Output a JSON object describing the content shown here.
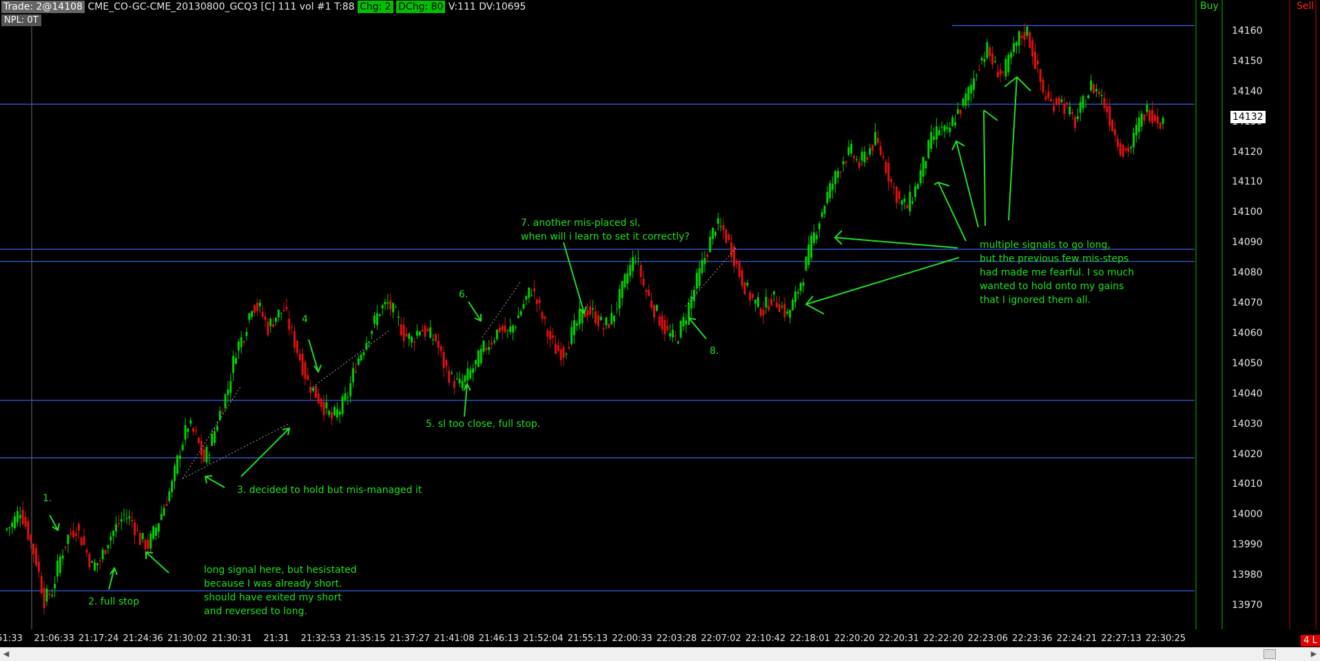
{
  "header": {
    "trade_label": "Trade: 2@14108",
    "instrument": "CME_CO-GC-CME_20130800_GCQ3 [C]  111 vol  #1 T:88",
    "chg": "Chg: 2",
    "dchg": "DChg: 80",
    "volume": "V:111 DV:10695"
  },
  "npl": "NPL: 0T",
  "columns": {
    "buy": "Buy",
    "sell": "Sell"
  },
  "last_price": "14132",
  "badge": "4 L",
  "price_axis": [
    "14160",
    "14150",
    "14140",
    "14130",
    "14120",
    "14110",
    "14100",
    "14090",
    "14080",
    "14070",
    "14060",
    "14050",
    "14040",
    "14030",
    "14020",
    "14010",
    "14000",
    "13990",
    "13980",
    "13970"
  ],
  "time_axis": [
    "51:33",
    "21:06:33",
    "21:17:24",
    "21:24:36",
    "21:30:02",
    "21:30:31",
    "21:31",
    "21:32:53",
    "21:35:15",
    "21:37:27",
    "21:41:08",
    "21:46:13",
    "21:52:04",
    "21:55:13",
    "22:00:33",
    "22:03:28",
    "22:07:02",
    "22:10:42",
    "22:18:01",
    "22:20:20",
    "22:20:31",
    "22:22:20",
    "22:23:06",
    "22:23:36",
    "22:24:21",
    "22:27:13",
    "22:30:25"
  ],
  "horizontal_levels": [
    14162,
    14136,
    14088,
    14084,
    14038,
    14019,
    13975
  ],
  "annotations": {
    "a1": "1.",
    "a2": "2. full stop",
    "long_signal": [
      "long signal here, but hesistated",
      "because I was already short.",
      "should have exited my short",
      "and reversed to long."
    ],
    "a3": "3. decided to hold but mis-managed it",
    "a4": "4",
    "a5": "5. sl too close, full stop.",
    "a6": "6.",
    "a7": [
      "7. another mis-placed sl,",
      "when will i learn to set it correctly?"
    ],
    "a8": "8.",
    "multiple": [
      "multiple signals to go long,",
      "but the previous few mis-steps",
      "had made me fearful. I so much",
      "wanted to hold onto my gains",
      "that I ignored them all."
    ]
  },
  "colors": {
    "up": "#00d000",
    "down": "#e01010",
    "level": "#2d54c8",
    "annotation": "#20e020",
    "background": "#000000"
  },
  "price_series": [
    13995,
    13997,
    14002,
    13994,
    13985,
    13972,
    13975,
    13986,
    13993,
    13996,
    13990,
    13983,
    13985,
    13992,
    13996,
    14000,
    13998,
    13992,
    13990,
    13996,
    14003,
    14010,
    14022,
    14030,
    14026,
    14018,
    14025,
    14034,
    14042,
    14055,
    14060,
    14070,
    14068,
    14062,
    14066,
    14068,
    14060,
    14052,
    14044,
    14040,
    14036,
    14032,
    14035,
    14040,
    14050,
    14056,
    14062,
    14068,
    14070,
    14066,
    14060,
    14058,
    14062,
    14060,
    14058,
    14050,
    14045,
    14043,
    14046,
    14050,
    14055,
    14058,
    14062,
    14060,
    14064,
    14070,
    14075,
    14068,
    14060,
    14055,
    14054,
    14060,
    14065,
    14068,
    14066,
    14062,
    14065,
    14072,
    14080,
    14086,
    14076,
    14070,
    14065,
    14060,
    14058,
    14064,
    14072,
    14080,
    14088,
    14096,
    14094,
    14088,
    14080,
    14074,
    14070,
    14068,
    14072,
    14070,
    14066,
    14072,
    14080,
    14090,
    14098,
    14106,
    14112,
    14118,
    14120,
    14116,
    14120,
    14124,
    14118,
    14110,
    14104,
    14102,
    14108,
    14116,
    14124,
    14128,
    14126,
    14132,
    14136,
    14142,
    14150,
    14154,
    14148,
    14146,
    14152,
    14158,
    14160,
    14150,
    14140,
    14136,
    14138,
    14134,
    14130,
    14136,
    14142,
    14140,
    14134,
    14126,
    14120,
    14122,
    14130,
    14134,
    14132,
    14130
  ]
}
